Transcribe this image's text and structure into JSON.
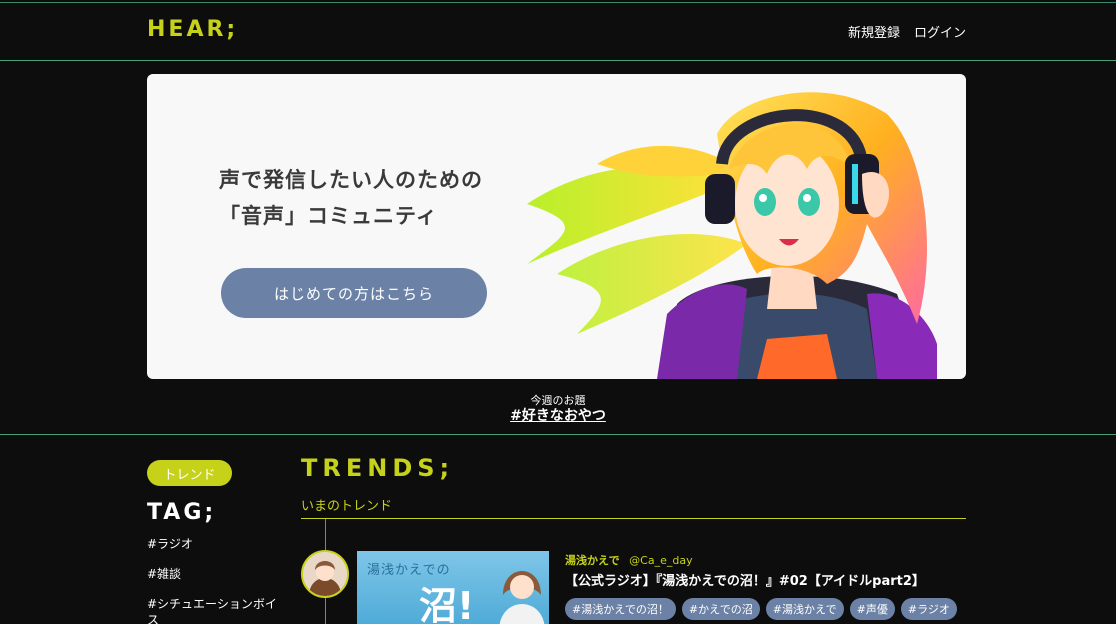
{
  "header": {
    "logo": "HEAR;",
    "nav": {
      "signup": "新規登録",
      "login": "ログイン"
    }
  },
  "hero": {
    "title_line1": "声で発信したい人のための",
    "title_line2": "「音声」コミュニティ",
    "cta": "はじめての方はこちら"
  },
  "weekly_topic": {
    "label": "今週のお題",
    "tag": "#好きなおやつ"
  },
  "sidebar": {
    "pill": "トレンド",
    "heading": "TAG;",
    "tags": [
      "#ラジオ",
      "#雑談",
      "#シチュエーションボイス"
    ]
  },
  "trends": {
    "heading": "TRENDS;",
    "subheading": "いまのトレンド",
    "posts": [
      {
        "user_name": "湯浅かえで",
        "user_handle": "@Ca_e_day",
        "title": "【公式ラジオ】『湯浅かえでの沼！』#02【アイドルpart2】",
        "thumb_text": "湯浅かえでの",
        "thumb_big": "沼!",
        "tags": [
          "#湯浅かえでの沼！",
          "#かえでの沼",
          "#湯浅かえで",
          "#声優",
          "#ラジオ"
        ]
      }
    ]
  },
  "colors": {
    "accent": "#c6d21a",
    "button": "#6b82a6",
    "divider": "#4aa07a",
    "background": "#0d0d0d"
  }
}
